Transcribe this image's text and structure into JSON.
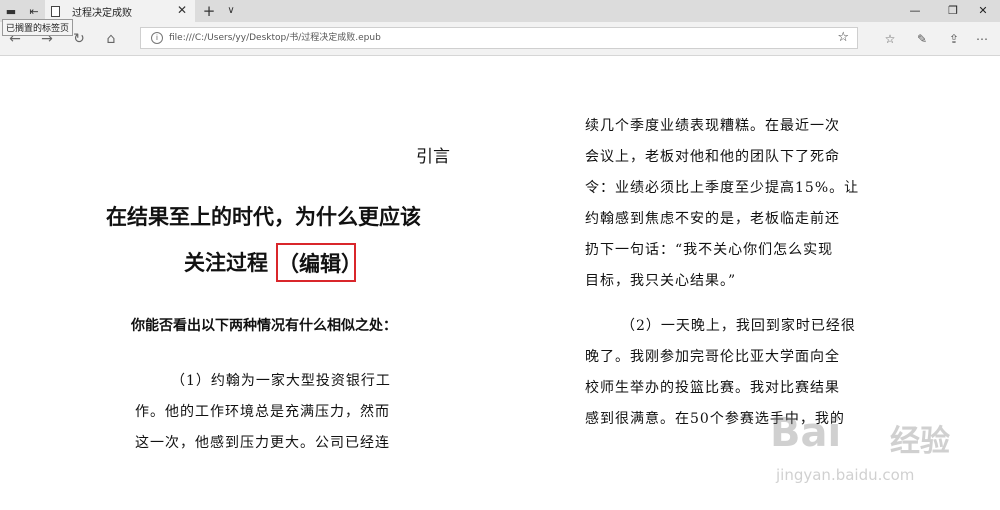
{
  "browser": {
    "tab_title": "过程决定成败",
    "tooltip": "已搁置的标签页",
    "url": "file:///C:/Users/yy/Desktop/书/过程决定成败.epub",
    "new_tab_glyph": "+",
    "tab_list_glyph": "∨",
    "close_glyph": "✕"
  },
  "book": {
    "section_title": "引言",
    "heading_line1": "在结果至上的时代，为什么更应该",
    "heading_line2": "关注过程",
    "heading_edit": "（编辑）",
    "question": "你能否看出以下两种情况有什么相似之处：",
    "left_paragraph": [
      "（1）约翰为一家大型投资银行工",
      "作。他的工作环境总是充满压力，然而",
      "这一次，他感到压力更大。公司已经连"
    ],
    "right_paragraph1": [
      "续几个季度业绩表现糟糕。在最近一次",
      "会议上，老板对他和他的团队下了死命",
      "令：业绩必须比上季度至少提高15%。让",
      "约翰感到焦虑不安的是，老板临走前还",
      "扔下一句话：“我不关心你们怎么实现",
      "目标，我只关心结果。”"
    ],
    "right_paragraph2": [
      "（2）一天晚上，我回到家时已经很",
      "晚了。我刚参加完哥伦比亚大学面向全",
      "校师生举办的投篮比赛。我对比赛结果",
      "感到很满意。在50个参赛选手中，我的"
    ]
  },
  "watermark": {
    "brand_latin": "Bai",
    "brand_cn": "经验",
    "url": "jingyan.baidu.com"
  },
  "colors": {
    "highlight_border": "#d9262b"
  }
}
